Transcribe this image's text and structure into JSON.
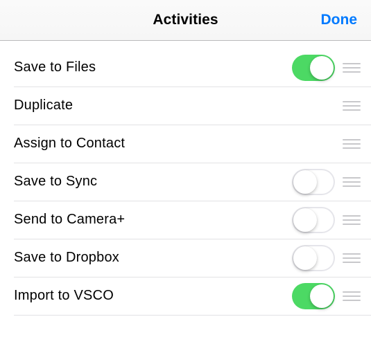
{
  "navbar": {
    "title": "Activities",
    "done": "Done"
  },
  "rows": [
    {
      "label": "Save to Files",
      "toggle": true,
      "hasToggle": true
    },
    {
      "label": "Duplicate",
      "toggle": null,
      "hasToggle": false
    },
    {
      "label": "Assign to Contact",
      "toggle": null,
      "hasToggle": false
    },
    {
      "label": "Save to Sync",
      "toggle": false,
      "hasToggle": true
    },
    {
      "label": "Send to Camera+",
      "toggle": false,
      "hasToggle": true
    },
    {
      "label": "Save to Dropbox",
      "toggle": false,
      "hasToggle": true
    },
    {
      "label": "Import to VSCO",
      "toggle": true,
      "hasToggle": true
    }
  ],
  "colors": {
    "accent": "#007aff",
    "switchOn": "#4cd964",
    "separator": "#e2e2e4"
  }
}
